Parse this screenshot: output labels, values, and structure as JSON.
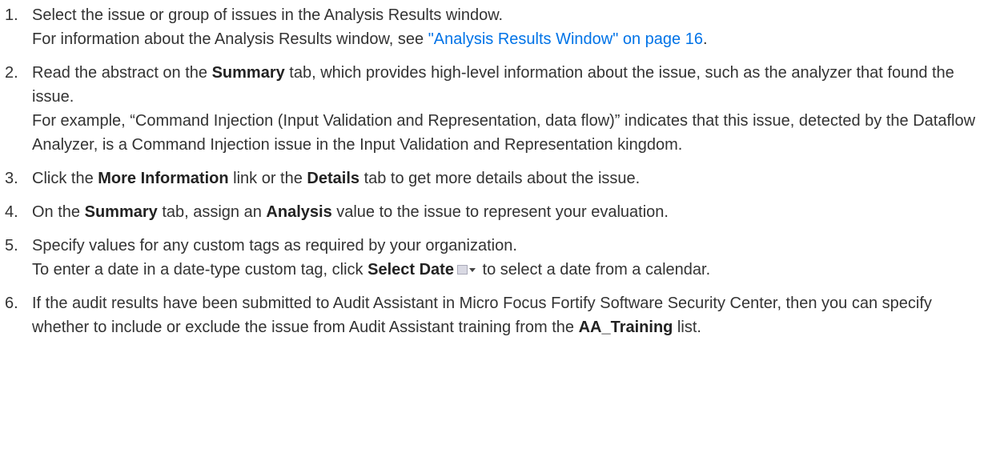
{
  "steps": [
    {
      "num": "1.",
      "text": "Select the issue or group of issues in the Analysis Results window.",
      "note_pre": "For information about the Analysis Results window, see ",
      "note_link": "\"Analysis Results Window\" on page 16",
      "note_post": "."
    },
    {
      "num": "2.",
      "t1": "Read the abstract on the ",
      "b1": "Summary",
      "t2": " tab, which provides high-level information about the issue, such as the analyzer that found the issue.",
      "note": "For example, “Command Injection (Input Validation and Representation, data flow)” indicates that this issue, detected by the Dataflow Analyzer, is a Command Injection issue in the Input Validation and Representation kingdom."
    },
    {
      "num": "3.",
      "t1": "Click the ",
      "b1": "More Information",
      "t2": " link or the ",
      "b2": "Details",
      "t3": " tab to get more details about the issue."
    },
    {
      "num": "4.",
      "t1": "On the ",
      "b1": "Summary",
      "t2": " tab, assign an ",
      "b2": "Analysis",
      "t3": " value to the issue to represent your evaluation."
    },
    {
      "num": "5.",
      "text": "Specify values for any custom tags as required by your organization.",
      "n1": "To enter a date in a date-type custom tag, click ",
      "nb": "Select Date",
      "icon": "calendar-dropdown-icon",
      "n2": " to select a date from a calendar."
    },
    {
      "num": "6.",
      "t1": "If the audit results have been submitted to Audit Assistant in Micro Focus Fortify Software Security Center, then you can specify whether to include or exclude the issue from Audit Assistant training from the ",
      "b1": "AA_Training",
      "t2": " list."
    }
  ],
  "colors": {
    "text": "#333333",
    "link": "#0073e7"
  }
}
